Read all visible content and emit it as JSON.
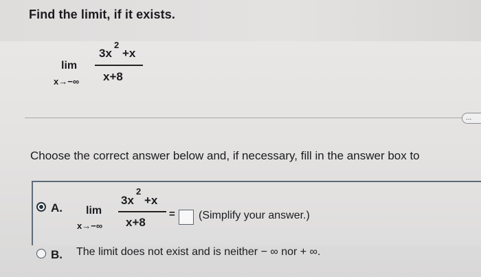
{
  "question": {
    "title": "Find the limit, if it exists.",
    "lim_word": "lim",
    "lim_sub": "x→−∞",
    "numerator": "3x",
    "numerator_exp": "2",
    "numerator_tail": "+x",
    "denominator": "x+8"
  },
  "more_button": "...",
  "prompt": "Choose the correct answer below and, if necessary, fill in the answer box to",
  "option_a": {
    "label": "A.",
    "selected": true,
    "lim_word": "lim",
    "lim_sub": "x→−∞",
    "numerator": "3x",
    "numerator_exp": "2",
    "numerator_tail": "+x",
    "denominator": "x+8",
    "equals": "=",
    "answer_value": "",
    "hint": "(Simplify your answer.)"
  },
  "option_b": {
    "label": "B.",
    "selected": false,
    "text": "The limit does not exist and is neither − ∞ nor + ∞."
  }
}
